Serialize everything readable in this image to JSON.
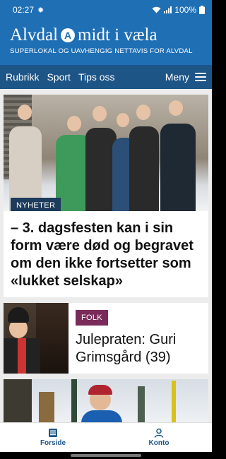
{
  "status_bar": {
    "time": "02:27",
    "battery": "100%",
    "icons": [
      "gear-icon",
      "wifi-icon",
      "signal-icon",
      "battery-icon"
    ]
  },
  "masthead": {
    "title_part1": "Alvdal",
    "badge_letter": "A",
    "title_part2": "midt i væla",
    "tagline": "SUPERLOKAL OG UAVHENGIG NETTAVIS FOR ALVDAL"
  },
  "nav": {
    "items": [
      {
        "label": "Rubrikk"
      },
      {
        "label": "Sport"
      },
      {
        "label": "Tips oss"
      }
    ],
    "menu_label": "Meny"
  },
  "articles": [
    {
      "tag": "NYHETER",
      "headline": "– 3. dagsfesten kan i sin form være død og begravet om den ikke fortsetter som «lukket selskap»"
    },
    {
      "tag": "FOLK",
      "headline": "Juleprаten: Guri Grimsgård (39)"
    }
  ],
  "bottom_nav": {
    "items": [
      {
        "label": "Forside",
        "icon": "newspaper-icon"
      },
      {
        "label": "Konto",
        "icon": "person-icon"
      }
    ]
  },
  "colors": {
    "brand_blue": "#1f6fb5",
    "nav_blue": "#1d5587",
    "tag_news": "#1d3b5c",
    "tag_folk": "#7a2b59"
  }
}
